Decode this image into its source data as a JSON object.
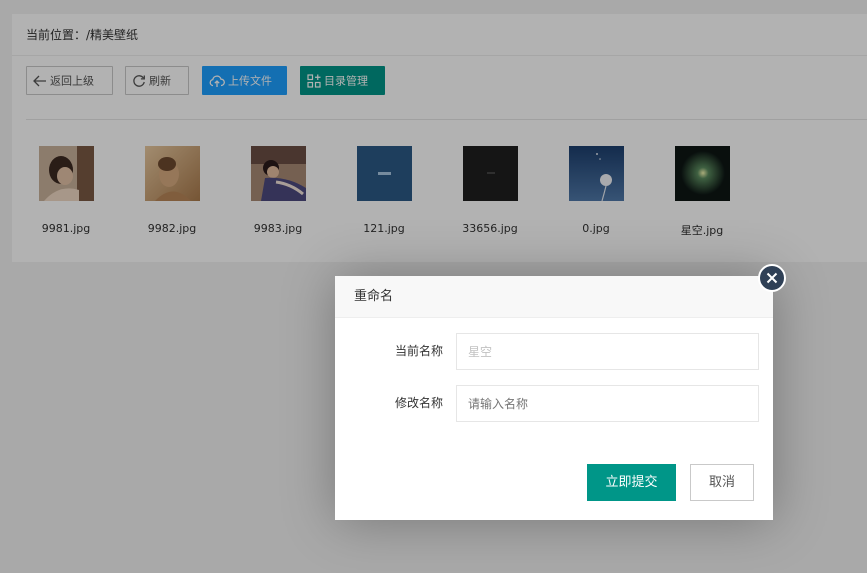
{
  "breadcrumb": {
    "text": "当前位置：/精美壁纸"
  },
  "toolbar": {
    "back_label": "返回上级",
    "refresh_label": "刷新",
    "upload_label": "上传文件",
    "dir_label": "目录管理"
  },
  "files": [
    {
      "name": "9981.jpg",
      "thumb_color": "#8a6a52"
    },
    {
      "name": "9982.jpg",
      "thumb_color": "#c59a6c"
    },
    {
      "name": "9983.jpg",
      "thumb_color": "#6e5c6d"
    },
    {
      "name": "121.jpg",
      "thumb_color": "#2b5a86"
    },
    {
      "name": "33656.jpg",
      "thumb_color": "#1f1f1f"
    },
    {
      "name": "0.jpg",
      "thumb_color": "#274a78"
    },
    {
      "name": "星空.jpg",
      "thumb_color": "#14241c"
    }
  ],
  "dialog": {
    "title": "重命名",
    "current_label": "当前名称",
    "current_placeholder": "星空",
    "new_label": "修改名称",
    "new_placeholder": "请输入名称",
    "submit_label": "立即提交",
    "cancel_label": "取消"
  },
  "colors": {
    "primary_blue": "#1e9fff",
    "primary_green": "#009688",
    "close_dark": "#2f4056"
  }
}
